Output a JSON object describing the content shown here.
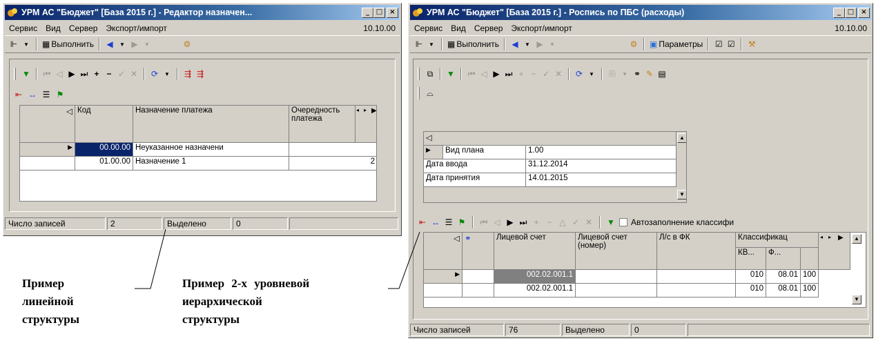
{
  "left_window": {
    "title": "УРМ АС \"Бюджет\" [База 2015 г.] - Редактор назначен...",
    "window_buttons": [
      "_",
      "□",
      "×"
    ],
    "menu": [
      "Сервис",
      "Вид",
      "Сервер",
      "Экспорт/импорт"
    ],
    "date": "10.10.00",
    "run_label": "Выполнить",
    "grid_headers": [
      "Код",
      "Назначение платежа",
      "Очередность платежа"
    ],
    "rows": [
      {
        "code": "00.00.00",
        "name": "Неуказанное назначени",
        "priority": ""
      },
      {
        "code": "01.00.00",
        "name": "Назначение 1",
        "priority": "2"
      }
    ],
    "status": {
      "records_label": "Число записей",
      "records_value": "2",
      "selected_label": "Выделено",
      "selected_value": "0"
    }
  },
  "right_window": {
    "title": "УРМ АС \"Бюджет\" [База 2015 г.] - Роспись по ПБС (расходы)",
    "window_buttons": [
      "_",
      "□",
      "×"
    ],
    "menu": [
      "Сервис",
      "Вид",
      "Сервер",
      "Экспорт/импорт"
    ],
    "date": "10.10.00",
    "run_label": "Выполнить",
    "params_label": "Параметры",
    "form_fields": [
      {
        "label": "Вид плана",
        "value": "1.00"
      },
      {
        "label": "Дата ввода",
        "value": "31.12.2014"
      },
      {
        "label": "Дата принятия",
        "value": "14.01.2015"
      }
    ],
    "autofill_label": "Автозаполнение классифи",
    "grid_headers": [
      "Лицевой счет",
      "Лицевой счет (номер)",
      "Л/с в ФК",
      "Классификац"
    ],
    "sub_headers": [
      "КВ...",
      "Ф...",
      ""
    ],
    "rows": [
      {
        "account": "002.02.001.1",
        "account_num": "",
        "fk": "",
        "kv": "010",
        "f": "08.01",
        "x": "100"
      },
      {
        "account": "002.02.001.1",
        "account_num": "",
        "fk": "",
        "kv": "010",
        "f": "08.01",
        "x": "100"
      }
    ],
    "status": {
      "records_label": "Число записей",
      "records_value": "76",
      "selected_label": "Выделено",
      "selected_value": "0"
    }
  },
  "captions": {
    "linear": [
      "Пример",
      "линейной",
      "структуры"
    ],
    "hierarchical_line1": "Пример 2-х уровневой",
    "hierarchical_rest": [
      "иерархической",
      "структуры"
    ]
  },
  "colors": {
    "titlebar": "#0a246a",
    "selection": "#0a246a",
    "face": "#d4d0c8"
  }
}
